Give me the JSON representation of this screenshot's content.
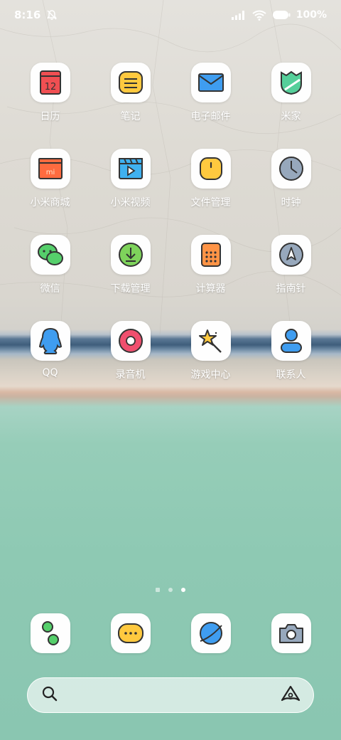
{
  "status_bar": {
    "time": "8:16",
    "battery_text": "100%",
    "icons": [
      "mute-bell-icon",
      "signal-icon",
      "wifi-icon",
      "battery-icon"
    ]
  },
  "apps": [
    {
      "label": "日历",
      "icon": "calendar-icon",
      "calendar_date": "12"
    },
    {
      "label": "笔记",
      "icon": "notes-icon"
    },
    {
      "label": "电子邮件",
      "icon": "email-icon"
    },
    {
      "label": "米家",
      "icon": "mijia-icon"
    },
    {
      "label": "小米商城",
      "icon": "mi-store-icon",
      "badge_text": "mi"
    },
    {
      "label": "小米视频",
      "icon": "video-icon"
    },
    {
      "label": "文件管理",
      "icon": "file-manager-icon"
    },
    {
      "label": "时钟",
      "icon": "clock-icon"
    },
    {
      "label": "微信",
      "icon": "wechat-icon"
    },
    {
      "label": "下载管理",
      "icon": "download-icon"
    },
    {
      "label": "计算器",
      "icon": "calculator-icon"
    },
    {
      "label": "指南针",
      "icon": "compass-icon"
    },
    {
      "label": "QQ",
      "icon": "qq-icon"
    },
    {
      "label": "录音机",
      "icon": "recorder-icon"
    },
    {
      "label": "游戏中心",
      "icon": "game-center-icon"
    },
    {
      "label": "联系人",
      "icon": "contacts-icon"
    }
  ],
  "page_indicator": {
    "count": 3,
    "active_index": 2
  },
  "dock": [
    {
      "icon": "phone-icon"
    },
    {
      "icon": "messages-icon"
    },
    {
      "icon": "browser-icon"
    },
    {
      "icon": "camera-icon"
    }
  ],
  "search": {
    "placeholder": "",
    "left_icon": "search-icon",
    "right_icon": "assistant-icon"
  },
  "colors": {
    "label_text": "#ffffff",
    "tile_bg": "#fefefe",
    "red": "#f04f52",
    "yellow": "#ffc93f",
    "blue": "#3f9df0",
    "green": "#55cf6b",
    "orange": "#ff9446",
    "gray_blue": "#97a8bc"
  }
}
